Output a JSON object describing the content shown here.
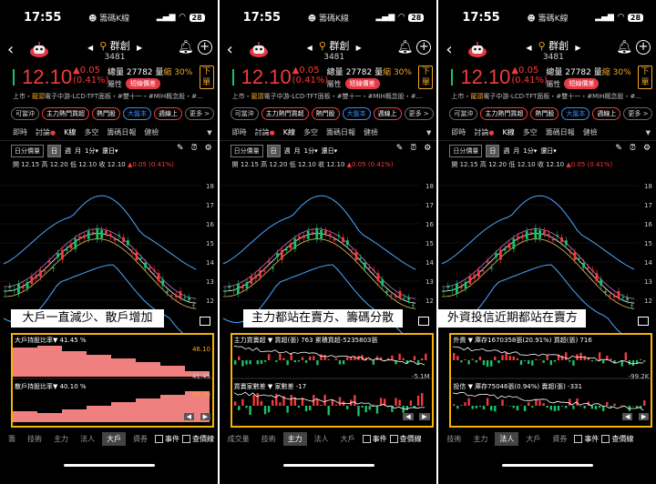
{
  "colors": {
    "up": "#f23b3b",
    "down": "#19c26b",
    "accent": "#f5a623",
    "highlight": "#f5b400"
  },
  "status": {
    "time": "17:55",
    "app": "籌碼K線",
    "battery": "28"
  },
  "stock": {
    "name": "群創",
    "code": "3481",
    "price": "12.10",
    "change": "▲0.05",
    "change_pct": "(0.41%)",
    "volume_label": "總量",
    "volume": "27782",
    "volume_unit": "量",
    "volume_note": "縮 30%",
    "attr_label": "屬性",
    "short_badge": "短線價差",
    "order_label": "下單",
    "desc_prefix": "上市・",
    "desc_bold": "龍頭",
    "desc_rest": "電子中游-LCD-TFT面板・#雙十一・#MIH概念股・#..."
  },
  "tags": [
    "可當沖",
    "主力熱門買超",
    "熱門股",
    "大盤本",
    "週線上",
    "更多 >"
  ],
  "nav_tabs": [
    "即時",
    "討論",
    "K線",
    "多空",
    "籌碼日報",
    "健檢"
  ],
  "controls": {
    "period": "日分價量",
    "day": "日",
    "week": "週",
    "month": "月",
    "minute": "1分▾",
    "adj": "還日▾"
  },
  "ohlc": {
    "open": "開 12.15",
    "high": "高 12.20",
    "low": "低 12.10",
    "close": "收 12.10",
    "change": "▲0.05 (0.41%)"
  },
  "y_ticks": [
    "18",
    "17",
    "16",
    "15",
    "14",
    "13",
    "12"
  ],
  "panels": [
    {
      "caption": "大戶一直減少、散戶增加",
      "ind1_label": "大戶持股比率▼  41.45 %",
      "ind1_hi": "46.10",
      "ind1_lo": "41.45",
      "ind2_label": "散戶持股比率▼  40.10 %",
      "ind2_hi": "40.10",
      "ind2_lo": "35",
      "bottom_tabs": [
        "籌",
        "技術",
        "主力",
        "法人",
        "大戶",
        "資券"
      ],
      "bottom_active": 4
    },
    {
      "caption": "主力都站在賣方、籌碼分散",
      "ind1_label": "主力買賣超 ▼  買超(張) 763  累積買超-5235803張",
      "ind1_hi": "",
      "ind1_lo": "-5.1M",
      "ind2_label": "買賣家數差 ▼  家數差 -17",
      "ind2_hi": "",
      "ind2_lo": "",
      "bottom_tabs": [
        "成交量",
        "技術",
        "主力",
        "法人",
        "大戶"
      ],
      "bottom_active": 2
    },
    {
      "caption": "外資投信近期都站在賣方",
      "ind1_label": "外資         ▼  庫存1670358張(20.91%)  買超(張) 716",
      "ind1_hi": "",
      "ind1_lo": "-99.2K",
      "ind2_label": "投信         ▼  庫存75046張(0.94%)  賣超(張) -331",
      "ind2_hi": "",
      "ind2_lo": "",
      "bottom_tabs": [
        "技術",
        "主力",
        "法人",
        "大戶",
        "資券"
      ],
      "bottom_active": 2
    }
  ],
  "checks": {
    "event": "事件",
    "debt": "查價線"
  }
}
